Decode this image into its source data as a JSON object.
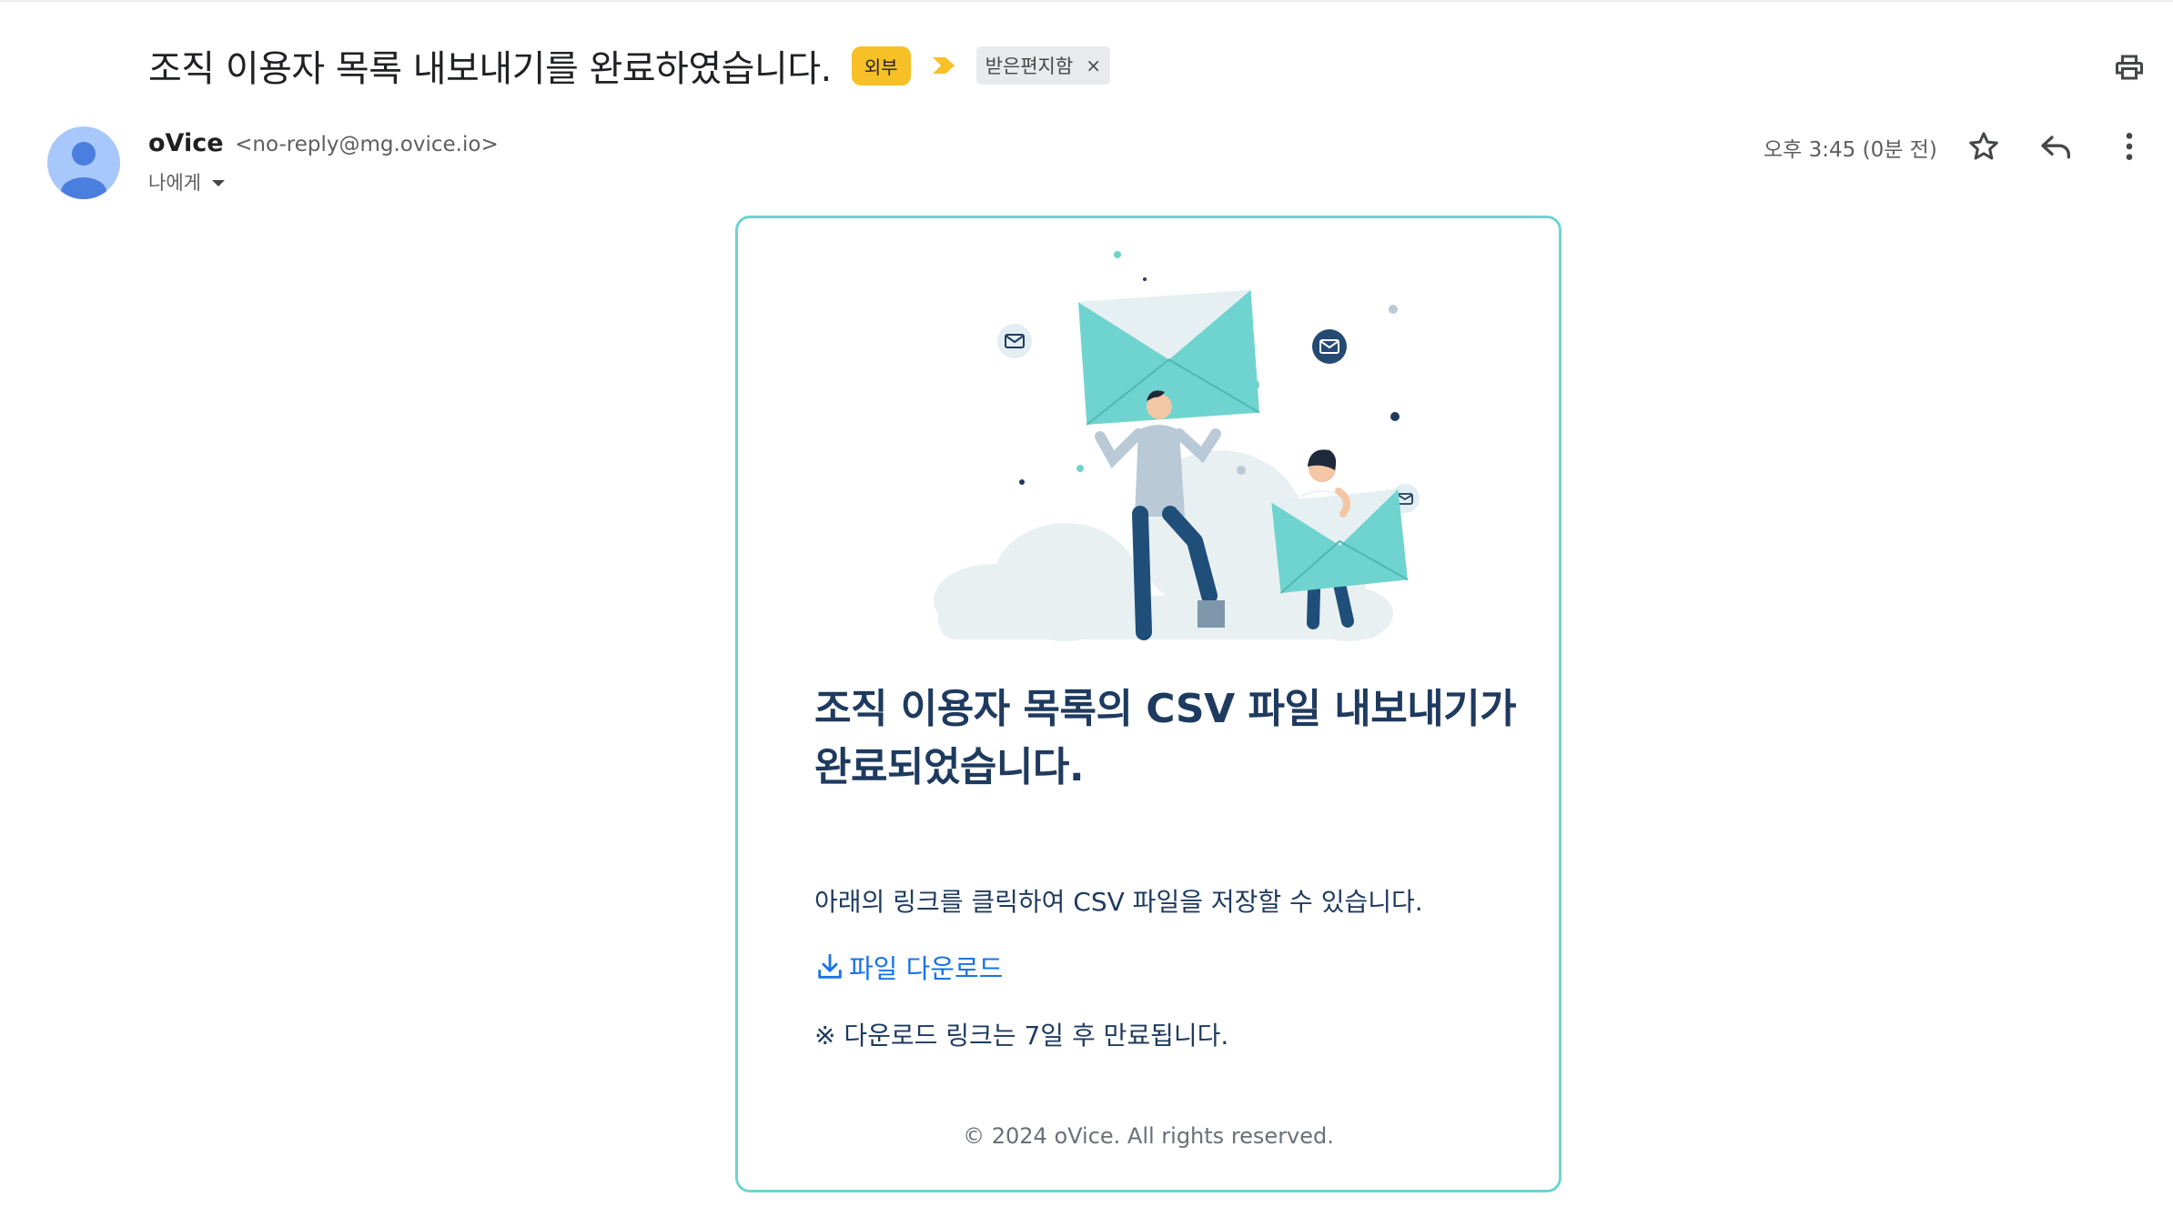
{
  "subject": {
    "title": "조직 이용자 목록 내보내기를 완료하였습니다.",
    "external_badge": "외부",
    "label": "받은편지함",
    "label_remove": "×"
  },
  "sender": {
    "name": "oVice",
    "email": "<no-reply@mg.ovice.io>",
    "to": "나에게",
    "time": "오후 3:45 (0분 전)"
  },
  "icons": {
    "print": "printer-icon",
    "star": "star-icon",
    "reply": "reply-icon",
    "more": "more-vert-icon",
    "download": "download-icon",
    "avatar": "person-icon",
    "arrow": "importance-arrow-icon"
  },
  "email": {
    "heading": "조직 이용자 목록의 CSV 파일 내보내기가 완료되었습니다.",
    "body": "아래의 링크를 클릭하여 CSV 파일을 저장할 수 있습니다.",
    "download_link": "파일 다운로드",
    "note": "※ 다운로드 링크는 7일 후 만료됩니다.",
    "footer": "© 2024 oVice. All rights reserved."
  },
  "colors": {
    "accent_border": "#6fd3cf",
    "heading": "#1e3a5f",
    "link": "#1a73e8",
    "external_badge": "#f6c026",
    "envelope": "#6fd3cf"
  }
}
